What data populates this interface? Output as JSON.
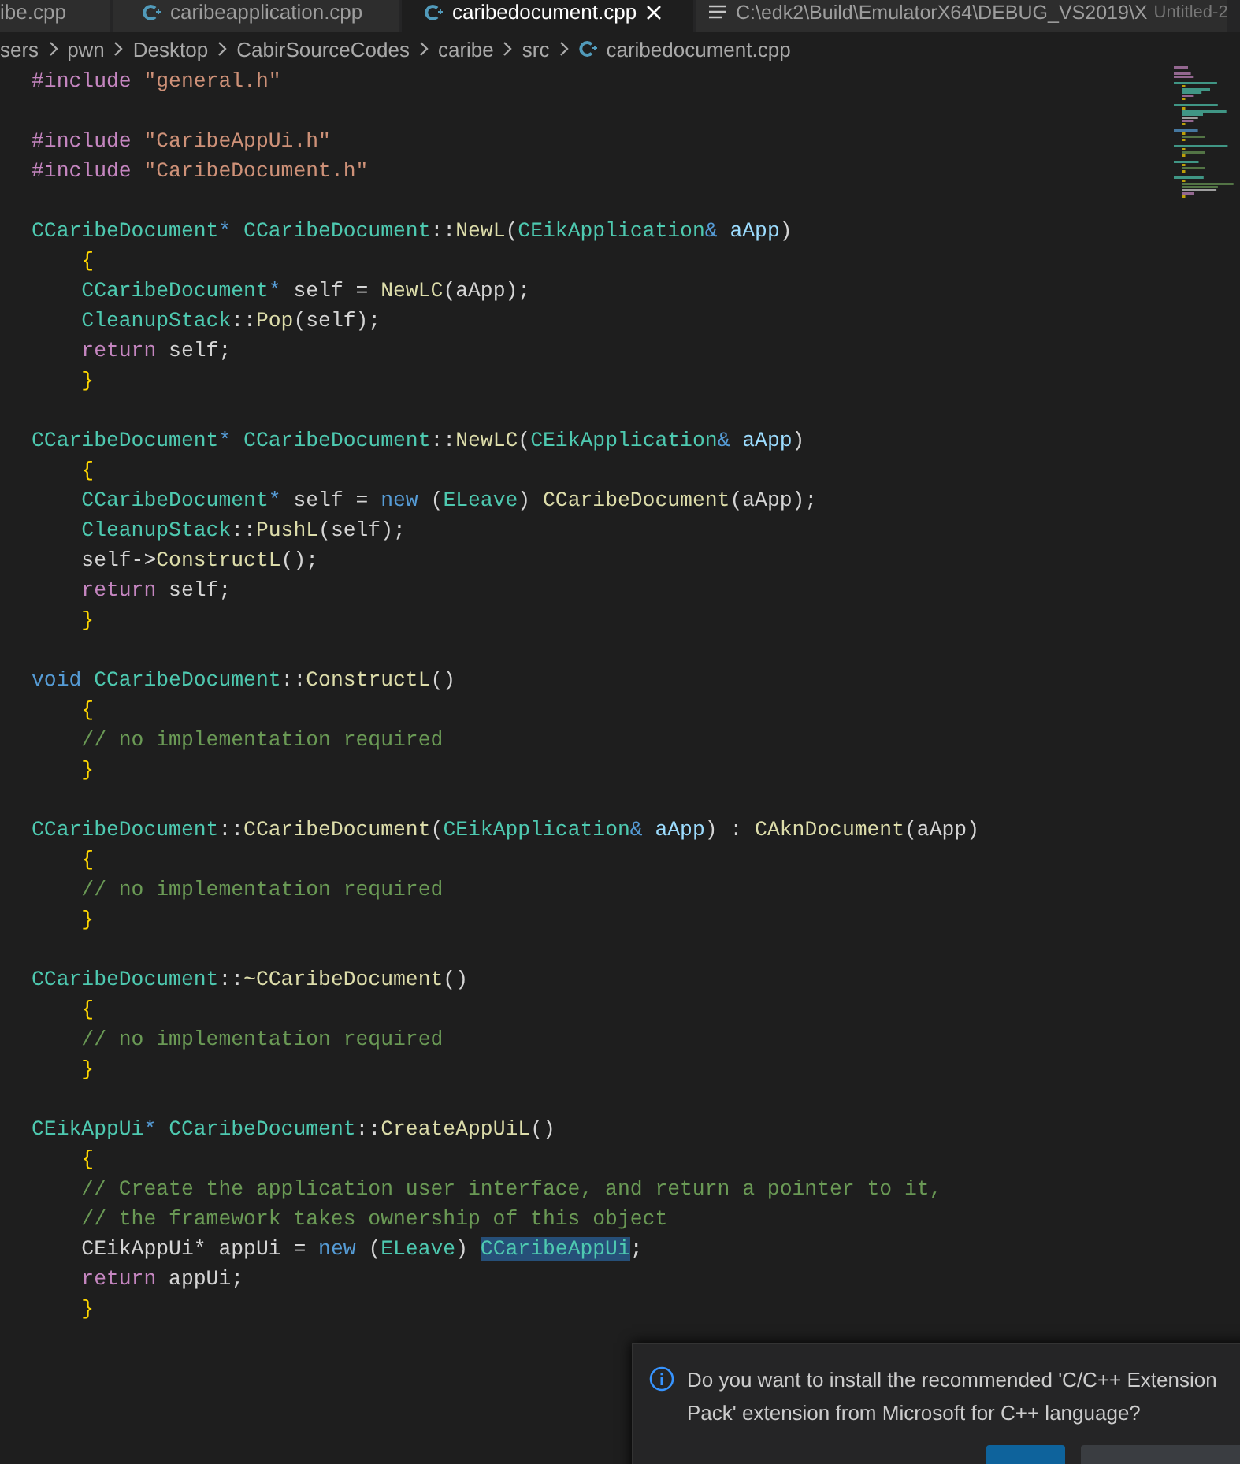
{
  "tabs": [
    {
      "label": "ibe.cpp",
      "kind": "plain",
      "selected": false,
      "closable": false
    },
    {
      "label": "caribeapplication.cpp",
      "kind": "cpp",
      "selected": false,
      "closable": false
    },
    {
      "label": "caribedocument.cpp",
      "kind": "cpp",
      "selected": true,
      "closable": true
    },
    {
      "label": "C:\\edk2\\Build\\EmulatorX64\\DEBUG_VS2019\\X",
      "kind": "text",
      "selected": false,
      "closable": false
    },
    {
      "label": "Untitled-2",
      "kind": "faded",
      "selected": false,
      "closable": false
    }
  ],
  "breadcrumb": [
    "sers",
    "pwn",
    "Desktop",
    "CabirSourceCodes",
    "caribe",
    "src"
  ],
  "breadcrumb_file": "caribedocument.cpp",
  "code_lines": [
    {
      "kind": "code",
      "tokens": [
        {
          "kind": "pre",
          "text": "#include "
        },
        {
          "kind": "str",
          "text": "\"general.h\""
        }
      ]
    },
    {
      "kind": "blank"
    },
    {
      "kind": "code",
      "tokens": [
        {
          "kind": "pre",
          "text": "#include "
        },
        {
          "kind": "str",
          "text": "\"CaribeAppUi.h\""
        }
      ]
    },
    {
      "kind": "code",
      "tokens": [
        {
          "kind": "pre",
          "text": "#include "
        },
        {
          "kind": "str",
          "text": "\"CaribeDocument.h\""
        }
      ]
    },
    {
      "kind": "blank"
    },
    {
      "kind": "code",
      "tokens": [
        {
          "kind": "type",
          "text": "CCaribeDocument"
        },
        {
          "kind": "kw",
          "text": "* "
        },
        {
          "kind": "type",
          "text": "CCaribeDocument"
        },
        {
          "kind": "plain",
          "text": "::"
        },
        {
          "kind": "func",
          "text": "NewL"
        },
        {
          "kind": "plain",
          "text": "("
        },
        {
          "kind": "type",
          "text": "CEikApplication"
        },
        {
          "kind": "kw",
          "text": "& "
        },
        {
          "kind": "var",
          "text": "aApp"
        },
        {
          "kind": "plain",
          "text": ")"
        }
      ]
    },
    {
      "kind": "code",
      "tokens": [
        {
          "kind": "brace",
          "text": "    {"
        }
      ]
    },
    {
      "kind": "code",
      "tokens": [
        {
          "kind": "type",
          "text": "    CCaribeDocument"
        },
        {
          "kind": "kw",
          "text": "*"
        },
        {
          "kind": "plain",
          "text": " self = "
        },
        {
          "kind": "func",
          "text": "NewLC"
        },
        {
          "kind": "plain",
          "text": "(aApp);"
        }
      ]
    },
    {
      "kind": "code",
      "tokens": [
        {
          "kind": "type",
          "text": "    CleanupStack"
        },
        {
          "kind": "plain",
          "text": "::"
        },
        {
          "kind": "func",
          "text": "Pop"
        },
        {
          "kind": "plain",
          "text": "(self);"
        }
      ]
    },
    {
      "kind": "code",
      "tokens": [
        {
          "kind": "ctrl",
          "text": "    return"
        },
        {
          "kind": "plain",
          "text": " self;"
        }
      ]
    },
    {
      "kind": "code",
      "tokens": [
        {
          "kind": "brace",
          "text": "    }"
        }
      ]
    },
    {
      "kind": "blank"
    },
    {
      "kind": "code",
      "tokens": [
        {
          "kind": "type",
          "text": "CCaribeDocument"
        },
        {
          "kind": "kw",
          "text": "* "
        },
        {
          "kind": "type",
          "text": "CCaribeDocument"
        },
        {
          "kind": "plain",
          "text": "::"
        },
        {
          "kind": "func",
          "text": "NewLC"
        },
        {
          "kind": "plain",
          "text": "("
        },
        {
          "kind": "type",
          "text": "CEikApplication"
        },
        {
          "kind": "kw",
          "text": "& "
        },
        {
          "kind": "var",
          "text": "aApp"
        },
        {
          "kind": "plain",
          "text": ")"
        }
      ]
    },
    {
      "kind": "code",
      "tokens": [
        {
          "kind": "brace",
          "text": "    {"
        }
      ]
    },
    {
      "kind": "code",
      "tokens": [
        {
          "kind": "type",
          "text": "    CCaribeDocument"
        },
        {
          "kind": "kw",
          "text": "*"
        },
        {
          "kind": "plain",
          "text": " self = "
        },
        {
          "kind": "kw",
          "text": "new"
        },
        {
          "kind": "plain",
          "text": " ("
        },
        {
          "kind": "type",
          "text": "ELeave"
        },
        {
          "kind": "plain",
          "text": ") "
        },
        {
          "kind": "func",
          "text": "CCaribeDocument"
        },
        {
          "kind": "plain",
          "text": "(aApp);"
        }
      ]
    },
    {
      "kind": "code",
      "tokens": [
        {
          "kind": "type",
          "text": "    CleanupStack"
        },
        {
          "kind": "plain",
          "text": "::"
        },
        {
          "kind": "func",
          "text": "PushL"
        },
        {
          "kind": "plain",
          "text": "(self);"
        }
      ]
    },
    {
      "kind": "code",
      "tokens": [
        {
          "kind": "plain",
          "text": "    self->"
        },
        {
          "kind": "func",
          "text": "ConstructL"
        },
        {
          "kind": "plain",
          "text": "();"
        }
      ]
    },
    {
      "kind": "code",
      "tokens": [
        {
          "kind": "ctrl",
          "text": "    return"
        },
        {
          "kind": "plain",
          "text": " self;"
        }
      ]
    },
    {
      "kind": "code",
      "tokens": [
        {
          "kind": "brace",
          "text": "    }"
        }
      ]
    },
    {
      "kind": "blank"
    },
    {
      "kind": "code",
      "tokens": [
        {
          "kind": "kw",
          "text": "void "
        },
        {
          "kind": "type",
          "text": "CCaribeDocument"
        },
        {
          "kind": "plain",
          "text": "::"
        },
        {
          "kind": "func",
          "text": "ConstructL"
        },
        {
          "kind": "plain",
          "text": "()"
        }
      ]
    },
    {
      "kind": "code",
      "tokens": [
        {
          "kind": "brace",
          "text": "    {"
        }
      ]
    },
    {
      "kind": "code",
      "tokens": [
        {
          "kind": "comment",
          "text": "    // no implementation required"
        }
      ]
    },
    {
      "kind": "code",
      "tokens": [
        {
          "kind": "brace",
          "text": "    }"
        }
      ]
    },
    {
      "kind": "blank"
    },
    {
      "kind": "code",
      "tokens": [
        {
          "kind": "type",
          "text": "CCaribeDocument"
        },
        {
          "kind": "plain",
          "text": "::"
        },
        {
          "kind": "func",
          "text": "CCaribeDocument"
        },
        {
          "kind": "plain",
          "text": "("
        },
        {
          "kind": "type",
          "text": "CEikApplication"
        },
        {
          "kind": "kw",
          "text": "& "
        },
        {
          "kind": "var",
          "text": "aApp"
        },
        {
          "kind": "plain",
          "text": ") : "
        },
        {
          "kind": "func",
          "text": "CAknDocument"
        },
        {
          "kind": "plain",
          "text": "(aApp)"
        }
      ]
    },
    {
      "kind": "code",
      "tokens": [
        {
          "kind": "brace",
          "text": "    {"
        }
      ]
    },
    {
      "kind": "code",
      "tokens": [
        {
          "kind": "comment",
          "text": "    // no implementation required"
        }
      ]
    },
    {
      "kind": "code",
      "tokens": [
        {
          "kind": "brace",
          "text": "    }"
        }
      ]
    },
    {
      "kind": "blank"
    },
    {
      "kind": "code",
      "tokens": [
        {
          "kind": "type",
          "text": "CCaribeDocument"
        },
        {
          "kind": "plain",
          "text": "::"
        },
        {
          "kind": "func",
          "text": "~CCaribeDocument"
        },
        {
          "kind": "plain",
          "text": "()"
        }
      ]
    },
    {
      "kind": "code",
      "tokens": [
        {
          "kind": "brace",
          "text": "    {"
        }
      ]
    },
    {
      "kind": "code",
      "tokens": [
        {
          "kind": "comment",
          "text": "    // no implementation required"
        }
      ]
    },
    {
      "kind": "code",
      "tokens": [
        {
          "kind": "brace",
          "text": "    }"
        }
      ]
    },
    {
      "kind": "blank"
    },
    {
      "kind": "code",
      "tokens": [
        {
          "kind": "type",
          "text": "CEikAppUi"
        },
        {
          "kind": "kw",
          "text": "* "
        },
        {
          "kind": "type",
          "text": "CCaribeDocument"
        },
        {
          "kind": "plain",
          "text": "::"
        },
        {
          "kind": "func",
          "text": "CreateAppUiL"
        },
        {
          "kind": "plain",
          "text": "()"
        }
      ]
    },
    {
      "kind": "code",
      "tokens": [
        {
          "kind": "brace",
          "text": "    {"
        }
      ]
    },
    {
      "kind": "code",
      "tokens": [
        {
          "kind": "comment",
          "text": "    // Create the application user interface, and return a pointer to it,"
        }
      ]
    },
    {
      "kind": "code",
      "tokens": [
        {
          "kind": "comment",
          "text": "    // the framework takes ownership of this object"
        }
      ]
    },
    {
      "kind": "code",
      "tokens": [
        {
          "kind": "plain",
          "text": "    CEikAppUi* appUi = "
        },
        {
          "kind": "kw",
          "text": "new"
        },
        {
          "kind": "plain",
          "text": " ("
        },
        {
          "kind": "type",
          "text": "ELeave"
        },
        {
          "kind": "plain",
          "text": ") "
        },
        {
          "kind": "sel",
          "text": "CCaribeAppUi"
        },
        {
          "kind": "plain",
          "text": ";"
        }
      ]
    },
    {
      "kind": "code",
      "tokens": [
        {
          "kind": "ctrl",
          "text": "    return"
        },
        {
          "kind": "plain",
          "text": " appUi;"
        }
      ]
    },
    {
      "kind": "code",
      "tokens": [
        {
          "kind": "brace",
          "text": "    }"
        }
      ]
    }
  ],
  "notification": {
    "message": "Do you want to install the recommended 'C/C++ Extension Pack' extension from Microsoft for C++ language?",
    "buttons": [
      {
        "kind": "primary"
      },
      {
        "kind": "secondary"
      }
    ]
  }
}
